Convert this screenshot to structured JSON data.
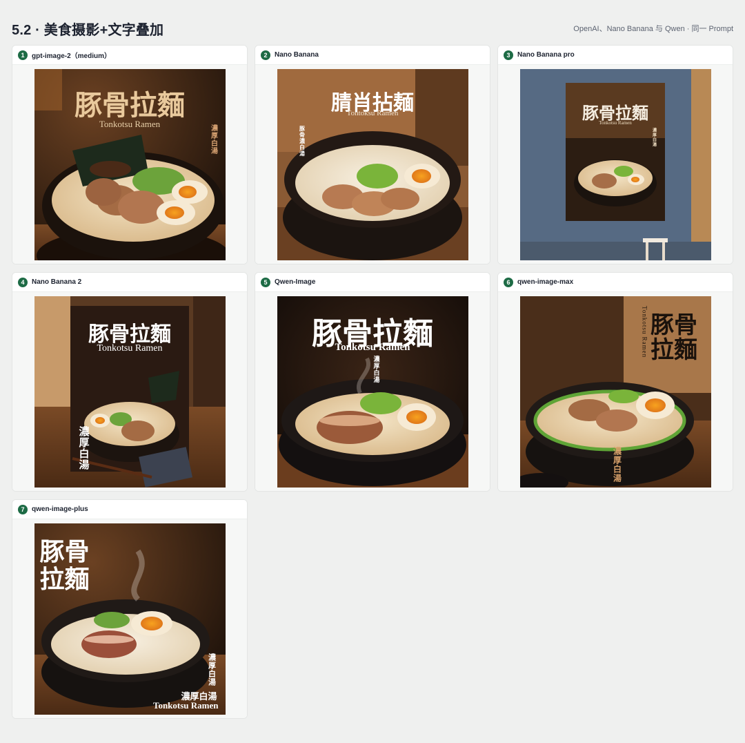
{
  "header": {
    "title": "5.2 · 美食摄影+文字叠加",
    "subtitle": "OpenAI、Nano Banana 与 Qwen · 同一 Prompt"
  },
  "colors": {
    "badge": "#1d6b45",
    "background": "#eff0ef",
    "card": "#ffffff"
  },
  "cards": [
    {
      "index": "1",
      "model": "gpt-image-2（medium）",
      "image": {
        "title": "豚骨拉麵",
        "subtitle": "Tonkotsu Ramen",
        "vertical": "濃厚白湯"
      }
    },
    {
      "index": "2",
      "model": "Nano Banana",
      "image": {
        "title": "腈肖拈麺",
        "subtitle": "Tontoksu Ramen",
        "vertical": "豚骨濃白湯"
      }
    },
    {
      "index": "3",
      "model": "Nano Banana pro",
      "image": {
        "title": "豚骨拉麵",
        "subtitle": "Tonkotsu Ramen",
        "vertical": "濃厚白湯"
      }
    },
    {
      "index": "4",
      "model": "Nano Banana 2",
      "image": {
        "title": "豚骨拉麵",
        "subtitle": "Tonkotsu Ramen",
        "vertical": "濃厚白湯"
      }
    },
    {
      "index": "5",
      "model": "Qwen-Image",
      "image": {
        "title": "豚骨拉麵",
        "subtitle": "Tonkotsu Ramen",
        "vertical": "濃厚白湯"
      }
    },
    {
      "index": "6",
      "model": "qwen-image-max",
      "image": {
        "title_line1": "豚骨",
        "title_line2": "拉麵",
        "subtitle": "Tonkotsu Ramen",
        "vertical": "濃厚白湯"
      }
    },
    {
      "index": "7",
      "model": "qwen-image-plus",
      "image": {
        "title_line1": "豚骨",
        "title_line2": "拉麵",
        "subtitle": "Tonkotsu Ramen",
        "vertical": "濃厚白湯",
        "caption": "濃厚白湯"
      }
    }
  ]
}
